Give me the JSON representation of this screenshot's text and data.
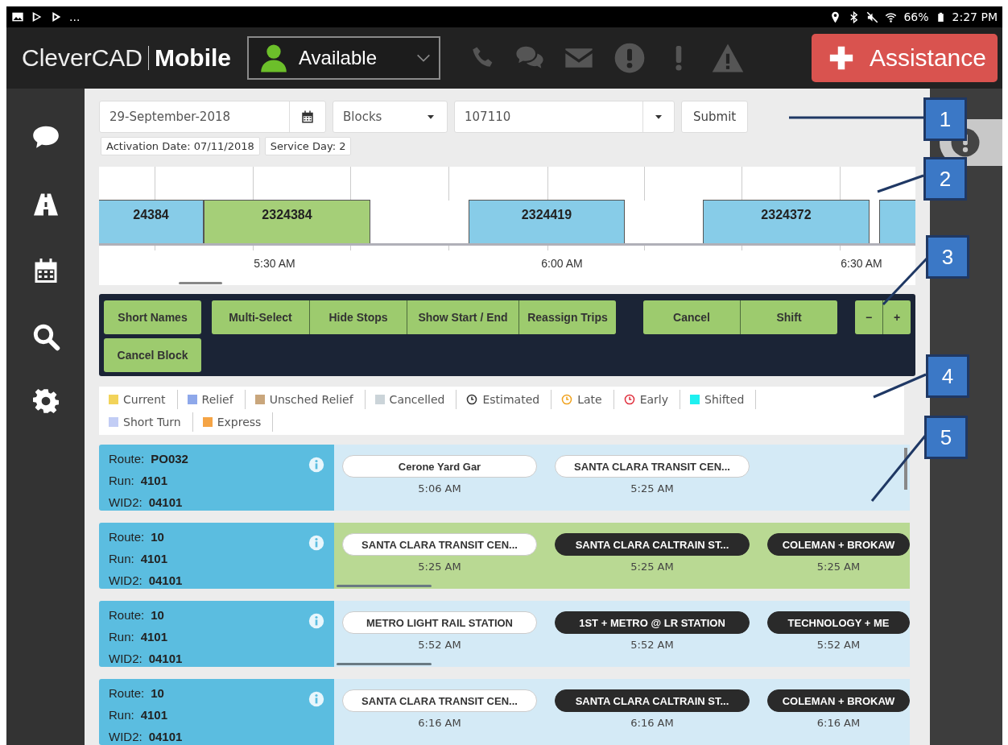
{
  "status_bar": {
    "overflow": "...",
    "battery": "66%",
    "time": "2:27 PM"
  },
  "header": {
    "brand": "CleverCAD",
    "product": "Mobile",
    "status": "Available",
    "assistance": "Assistance"
  },
  "filters": {
    "date": "29-September-2018",
    "mode": "Blocks",
    "block": "107110",
    "submit": "Submit",
    "tags": [
      "Activation Date: 07/11/2018",
      "Service Day: 2"
    ]
  },
  "timeline": {
    "blocks": [
      {
        "label": "24384",
        "color": "#87cce8"
      },
      {
        "label": "2324384",
        "color": "#a5cf78"
      },
      {
        "label": "2324419",
        "color": "#87cce8"
      },
      {
        "label": "2324372",
        "color": "#87cce8"
      },
      {
        "color": "#87cce8"
      }
    ],
    "ticks": [
      "5:30 AM",
      "6:00 AM",
      "6:30 AM"
    ]
  },
  "toolbar": {
    "rows": [
      {
        "groups": [
          {
            "buttons": [
              "Short Names"
            ]
          },
          {
            "buttons": [
              "Multi-Select",
              "Hide Stops",
              "Show Start / End",
              "Reassign Trips"
            ]
          },
          {
            "buttons": [
              "Cancel",
              "Shift"
            ]
          },
          {
            "buttons": [
              "−",
              "+"
            ]
          }
        ]
      },
      {
        "groups": [
          {
            "buttons": [
              "Cancel Block"
            ]
          }
        ]
      }
    ]
  },
  "legend": [
    {
      "label": "Current",
      "kind": "swatch",
      "color": "#f2d35a"
    },
    {
      "label": "Relief",
      "kind": "swatch",
      "color": "#8ea8ea"
    },
    {
      "label": "Unsched Relief",
      "kind": "swatch",
      "color": "#c9a67c"
    },
    {
      "label": "Cancelled",
      "kind": "swatch",
      "color": "#cbd4d9"
    },
    {
      "label": "Estimated",
      "kind": "clock",
      "color": "#333333"
    },
    {
      "label": "Late",
      "kind": "clock",
      "color": "#f0a21e"
    },
    {
      "label": "Early",
      "kind": "clock",
      "color": "#e0303e"
    },
    {
      "label": "Shifted",
      "kind": "swatch",
      "color": "#1ef0f0"
    },
    {
      "label": "Short Turn",
      "kind": "swatch",
      "color": "#c2cdf5"
    },
    {
      "label": "Express",
      "kind": "swatch",
      "color": "#f5a445"
    }
  ],
  "rows": [
    {
      "fields": [
        {
          "label": "Route:",
          "value": "PO032"
        },
        {
          "label": "Run:",
          "value": "4101"
        },
        {
          "label": "WID2:",
          "value": "04101"
        }
      ],
      "selected": false,
      "stops": [
        {
          "name": "Cerone Yard Gar",
          "time": "5:06 AM",
          "kind": "light"
        },
        {
          "name": "SANTA CLARA TRANSIT CEN...",
          "time": "5:25 AM",
          "kind": "light"
        }
      ]
    },
    {
      "fields": [
        {
          "label": "Route:",
          "value": "10"
        },
        {
          "label": "Run:",
          "value": "4101"
        },
        {
          "label": "WID2:",
          "value": "04101"
        }
      ],
      "selected": true,
      "stops": [
        {
          "name": "SANTA CLARA TRANSIT CEN...",
          "time": "5:25 AM",
          "kind": "light"
        },
        {
          "name": "SANTA CLARA CALTRAIN ST...",
          "time": "5:25 AM",
          "kind": "dark"
        },
        {
          "name": "COLEMAN + BROKAW",
          "time": "5:25 AM",
          "kind": "dark"
        }
      ]
    },
    {
      "fields": [
        {
          "label": "Route:",
          "value": "10"
        },
        {
          "label": "Run:",
          "value": "4101"
        },
        {
          "label": "WID2:",
          "value": "04101"
        }
      ],
      "selected": false,
      "stops": [
        {
          "name": "METRO LIGHT RAIL STATION",
          "time": "5:52 AM",
          "kind": "light"
        },
        {
          "name": "1ST + METRO @ LR STATION",
          "time": "5:52 AM",
          "kind": "dark"
        },
        {
          "name": "TECHNOLOGY + ME",
          "time": "5:52 AM",
          "kind": "dark"
        }
      ]
    },
    {
      "fields": [
        {
          "label": "Route:",
          "value": "10"
        },
        {
          "label": "Run:",
          "value": "4101"
        },
        {
          "label": "WID2:",
          "value": "04101"
        }
      ],
      "selected": false,
      "stops": [
        {
          "name": "SANTA CLARA TRANSIT CEN...",
          "time": "6:16 AM",
          "kind": "light"
        },
        {
          "name": "SANTA CLARA CALTRAIN ST...",
          "time": "6:16 AM",
          "kind": "dark"
        },
        {
          "name": "COLEMAN + BROKAW",
          "time": "6:16 AM",
          "kind": "dark"
        }
      ]
    }
  ],
  "callouts": [
    "1",
    "2",
    "3",
    "4",
    "5"
  ]
}
